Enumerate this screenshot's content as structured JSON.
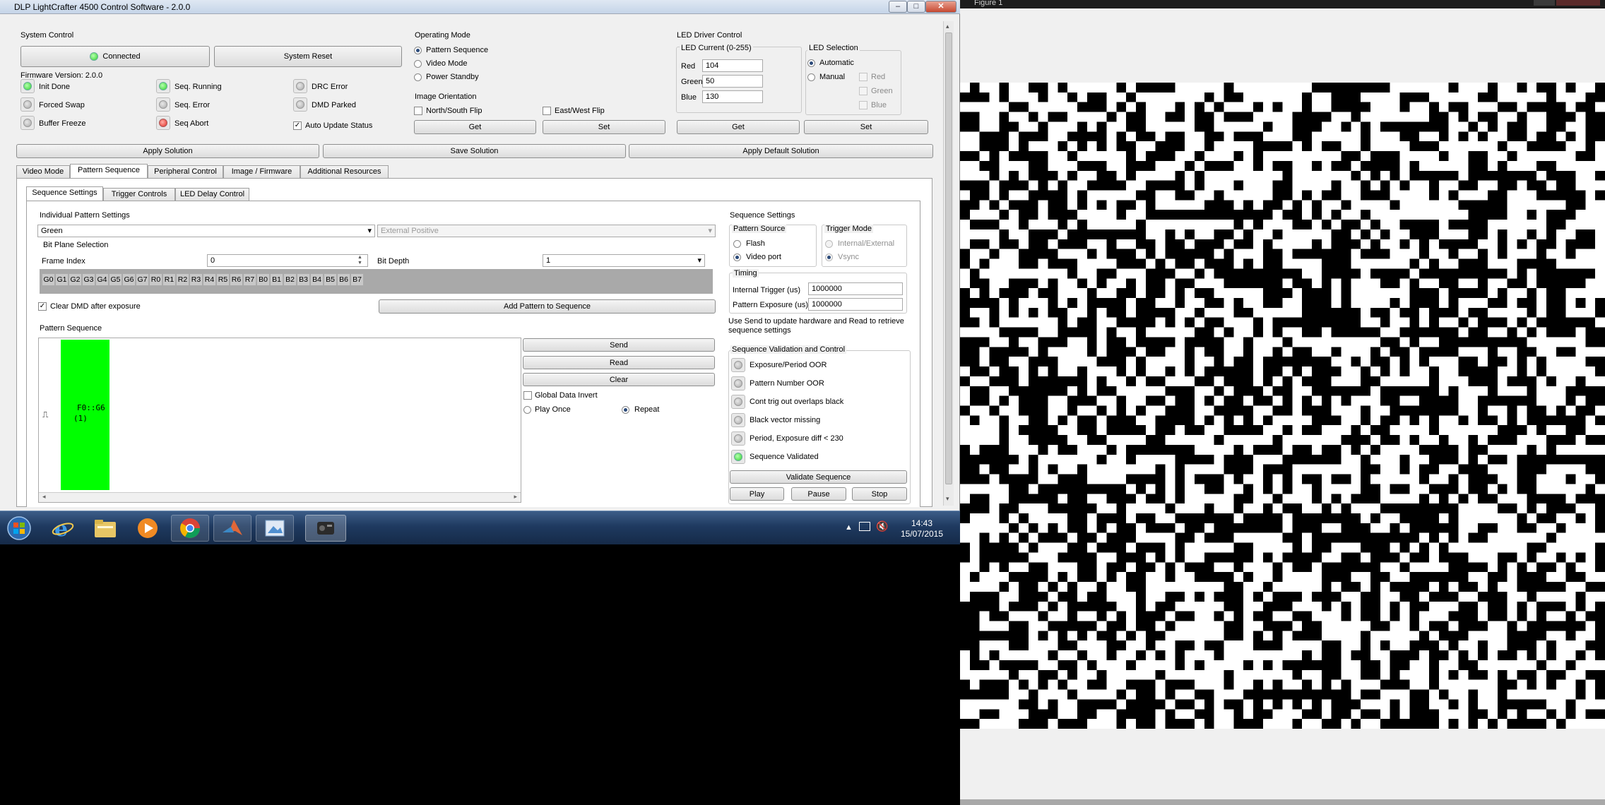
{
  "window": {
    "title": "DLP LightCrafter 4500 Control Software - 2.0.0",
    "min": "–",
    "max": "□",
    "close": "✕"
  },
  "system_control": {
    "label": "System Control",
    "connected_label": "Connected",
    "reset_label": "System Reset",
    "firmware": "Firmware Version:  2.0.0",
    "status": [
      {
        "label": "Init Done",
        "state": "green"
      },
      {
        "label": "Forced Swap",
        "state": "off"
      },
      {
        "label": "Buffer Freeze",
        "state": "off"
      },
      {
        "label": "Seq. Running",
        "state": "green"
      },
      {
        "label": "Seq. Error",
        "state": "off"
      },
      {
        "label": "Seq Abort",
        "state": "red"
      },
      {
        "label": "DRC Error",
        "state": "off"
      },
      {
        "label": "DMD Parked",
        "state": "off"
      }
    ],
    "auto_update": "Auto Update Status",
    "auto_update_checked": "✓"
  },
  "operating_mode": {
    "label": "Operating Mode",
    "options": [
      "Pattern Sequence",
      "Video Mode",
      "Power Standby"
    ],
    "selected": "Pattern Sequence"
  },
  "image_orientation": {
    "label": "Image Orientation",
    "ns_flip": "North/South Flip",
    "ew_flip": "East/West Flip",
    "get": "Get",
    "set": "Set"
  },
  "led_driver": {
    "label": "LED Driver Control",
    "current_label": "LED Current (0-255)",
    "red_label": "Red",
    "red": "104",
    "green_label": "Green",
    "green": "50",
    "blue_label": "Blue",
    "blue": "130",
    "selection_label": "LED Selection",
    "automatic": "Automatic",
    "manual": "Manual",
    "red_chk": "Red",
    "green_chk": "Green",
    "blue_chk": "Blue",
    "get": "Get",
    "set": "Set"
  },
  "solution": {
    "apply": "Apply Solution",
    "save": "Save Solution",
    "apply_default": "Apply Default Solution"
  },
  "tabs": [
    "Video Mode",
    "Pattern Sequence",
    "Peripheral Control",
    "Image / Firmware",
    "Additional Resources"
  ],
  "subtabs": [
    "Sequence Settings",
    "Trigger Controls",
    "LED Delay Control"
  ],
  "individual": {
    "label": "Individual Pattern Settings",
    "color": "Green",
    "trigger": "External Positive",
    "bitplane_label": "Bit Plane Selection",
    "frame_index_label": "Frame Index",
    "frame_index": "0",
    "bit_depth_label": "Bit Depth",
    "bit_depth": "1",
    "bits": [
      "G0",
      "G1",
      "G2",
      "G3",
      "G4",
      "G5",
      "G6",
      "G7",
      "R0",
      "R1",
      "R2",
      "R3",
      "R4",
      "R5",
      "R6",
      "R7",
      "B0",
      "B1",
      "B2",
      "B3",
      "B4",
      "B5",
      "B6",
      "B7"
    ],
    "clear_dmd": "Clear DMD after exposure",
    "clear_checked": "✓",
    "add_pattern": "Add Pattern to Sequence"
  },
  "pattern_sequence": {
    "label": "Pattern Sequence",
    "trigger_symbol": "⎍",
    "pattern_text_1": "F0::G6",
    "pattern_text_2": "(1)",
    "pattern_color": "#00ff00",
    "send": "Send",
    "read": "Read",
    "clear": "Clear",
    "global_invert": "Global Data Invert",
    "play_once": "Play Once",
    "repeat": "Repeat"
  },
  "sequence_settings": {
    "label": "Sequence Settings",
    "source_label": "Pattern Source",
    "flash": "Flash",
    "video_port": "Video port",
    "trigger_label": "Trigger Mode",
    "internal_external": "Internal/External",
    "vsync": "Vsync",
    "timing_label": "Timing",
    "internal_trigger_label": "Internal Trigger (us)",
    "internal_trigger": "1000000",
    "exposure_label": "Pattern Exposure (us)",
    "exposure": "1000000",
    "hint": "Use Send to update hardware and Read to retrieve sequence settings"
  },
  "validation": {
    "label": "Sequence Validation and Control",
    "items": [
      {
        "label": "Exposure/Period OOR",
        "state": "off"
      },
      {
        "label": "Pattern Number OOR",
        "state": "off"
      },
      {
        "label": "Cont trig out overlaps black",
        "state": "off"
      },
      {
        "label": "Black vector missing",
        "state": "off"
      },
      {
        "label": "Period, Exposure diff < 230",
        "state": "off"
      },
      {
        "label": "Sequence Validated",
        "state": "green"
      }
    ],
    "validate": "Validate Sequence",
    "play": "Play",
    "pause": "Pause",
    "stop": "Stop"
  },
  "taskbar": {
    "time": "14:43",
    "date": "15/07/2015",
    "apps": [
      "start-orb-icon",
      "internet-explorer-icon",
      "file-explorer-icon",
      "media-player-icon",
      "chrome-icon",
      "matlab-icon",
      "photo-viewer-icon",
      "lightcrafter-icon"
    ]
  },
  "figure": {
    "title": "Figure 1",
    "pattern_seed": 7
  }
}
